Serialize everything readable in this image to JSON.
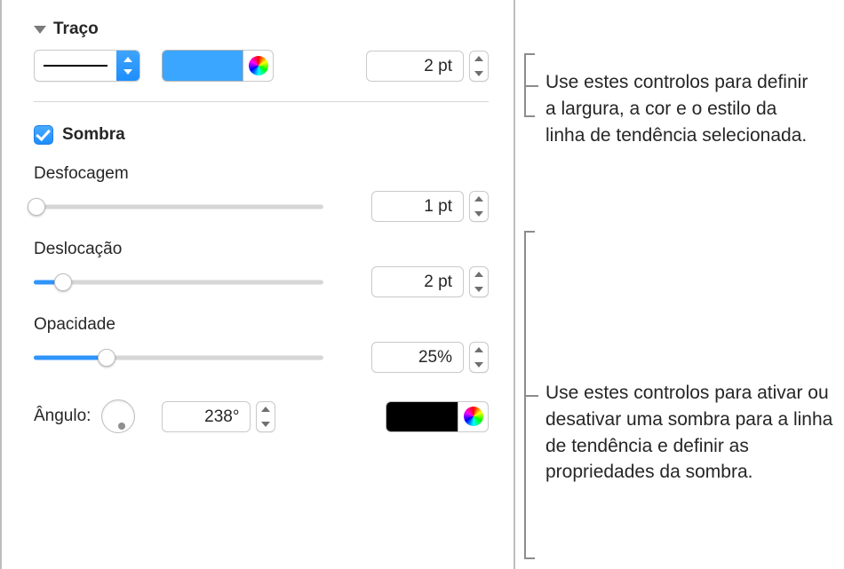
{
  "stroke": {
    "title": "Traço",
    "width_value": "2 pt",
    "color": "#3aa6ff"
  },
  "shadow": {
    "title": "Sombra",
    "checked": true,
    "blur": {
      "label": "Desfocagem",
      "value": "1 pt",
      "pct": 1
    },
    "offset": {
      "label": "Deslocação",
      "value": "2 pt",
      "pct": 10
    },
    "opacity": {
      "label": "Opacidade",
      "value": "25%",
      "pct": 25
    },
    "angle": {
      "label": "Ângulo:",
      "value": "238°"
    },
    "color": "#000000"
  },
  "callouts": {
    "stroke_help": "Use estes controlos para definir a largura, a cor e o estilo da linha de tendência selecionada.",
    "shadow_help": "Use estes controlos para ativar ou desativar uma sombra para a linha de tendência e definir as propriedades da sombra."
  }
}
